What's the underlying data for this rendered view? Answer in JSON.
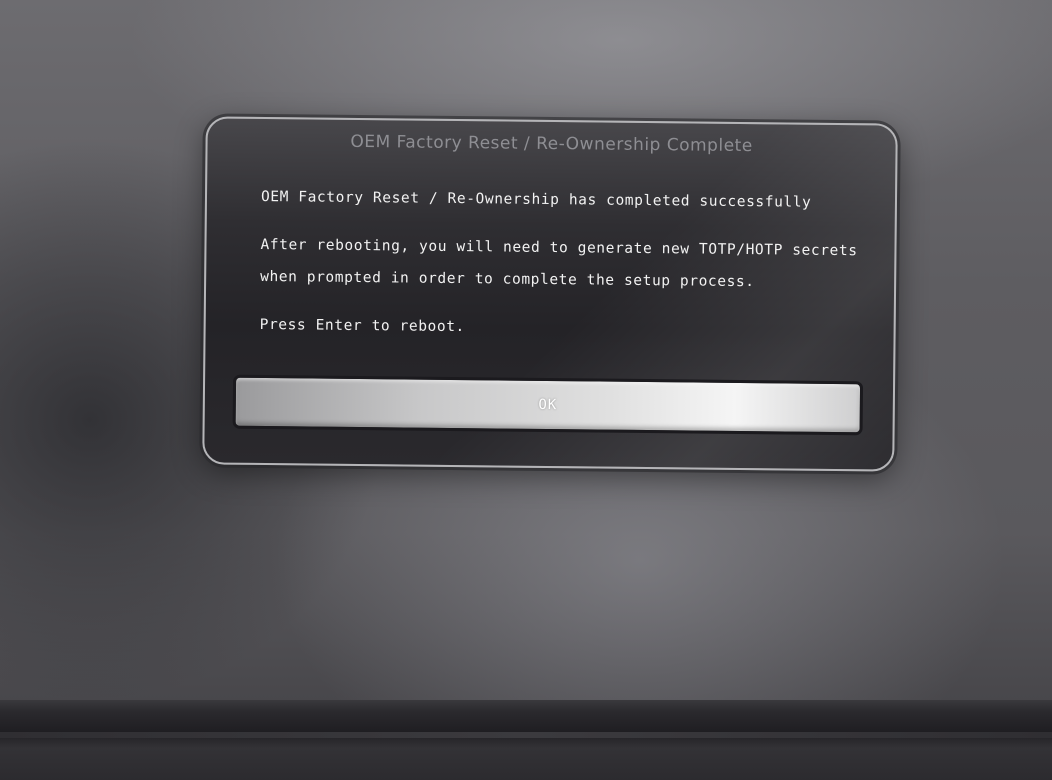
{
  "dialog": {
    "title": "OEM Factory Reset / Re-Ownership Complete",
    "message_line1": "OEM Factory Reset / Re-Ownership has completed successfully",
    "message_line2": "After rebooting, you will need to generate new TOTP/HOTP secrets",
    "message_line3": "when prompted in order to complete the setup process.",
    "message_line4": "Press Enter to reboot.",
    "ok_label": "OK"
  }
}
